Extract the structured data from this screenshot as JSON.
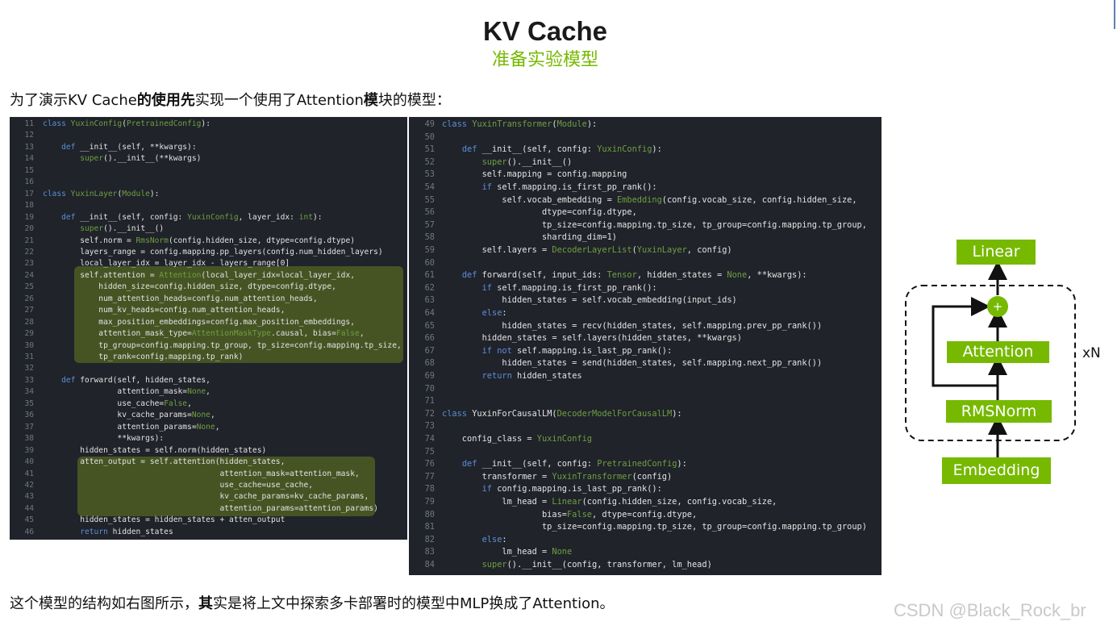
{
  "page": {
    "title": "KV Cache",
    "subtitle": "准备实验模型",
    "intro": {
      "p1": "为了演示KV Cache",
      "p2": "的使用先",
      "p3": "实现一个使用了Attention",
      "p4": "模",
      "p5": "块的模型："
    },
    "outro": {
      "p1": "这个模型的结构如右图所示，",
      "p2": "其",
      "p3": "实是将上文中探索多卡部署时的模型中MLP换成了Attention。"
    },
    "watermark": "CSDN @Black_Rock_br"
  },
  "code_left": {
    "lines": [
      {
        "n": "11",
        "t": "class YuxinConfig(PretrainedConfig):"
      },
      {
        "n": "12",
        "t": ""
      },
      {
        "n": "13",
        "t": "    def __init__(self, **kwargs):"
      },
      {
        "n": "14",
        "t": "        super().__init__(**kwargs)"
      },
      {
        "n": "15",
        "t": ""
      },
      {
        "n": "16",
        "t": ""
      },
      {
        "n": "17",
        "t": "class YuxinLayer(Module):"
      },
      {
        "n": "18",
        "t": ""
      },
      {
        "n": "19",
        "t": "    def __init__(self, config: YuxinConfig, layer_idx: int):"
      },
      {
        "n": "20",
        "t": "        super().__init__()"
      },
      {
        "n": "21",
        "t": "        self.norm = RmsNorm(config.hidden_size, dtype=config.dtype)"
      },
      {
        "n": "22",
        "t": "        layers_range = config.mapping.pp_layers(config.num_hidden_layers)"
      },
      {
        "n": "23",
        "t": "        local_layer_idx = layer_idx - layers_range[0]"
      },
      {
        "n": "24",
        "t": "        self.attention = Attention(local_layer_idx=local_layer_idx,"
      },
      {
        "n": "25",
        "t": "            hidden_size=config.hidden_size, dtype=config.dtype,"
      },
      {
        "n": "26",
        "t": "            num_attention_heads=config.num_attention_heads,"
      },
      {
        "n": "27",
        "t": "            num_kv_heads=config.num_attention_heads,"
      },
      {
        "n": "28",
        "t": "            max_position_embeddings=config.max_position_embeddings,"
      },
      {
        "n": "29",
        "t": "            attention_mask_type=AttentionMaskType.causal, bias=False,"
      },
      {
        "n": "30",
        "t": "            tp_group=config.mapping.tp_group, tp_size=config.mapping.tp_size,"
      },
      {
        "n": "31",
        "t": "            tp_rank=config.mapping.tp_rank)"
      },
      {
        "n": "32",
        "t": ""
      },
      {
        "n": "33",
        "t": "    def forward(self, hidden_states,"
      },
      {
        "n": "34",
        "t": "                attention_mask=None,"
      },
      {
        "n": "35",
        "t": "                use_cache=False,"
      },
      {
        "n": "36",
        "t": "                kv_cache_params=None,"
      },
      {
        "n": "37",
        "t": "                attention_params=None,"
      },
      {
        "n": "38",
        "t": "                **kwargs):"
      },
      {
        "n": "39",
        "t": "        hidden_states = self.norm(hidden_states)"
      },
      {
        "n": "40",
        "t": "        atten_output = self.attention(hidden_states,"
      },
      {
        "n": "41",
        "t": "                                      attention_mask=attention_mask,"
      },
      {
        "n": "42",
        "t": "                                      use_cache=use_cache,"
      },
      {
        "n": "43",
        "t": "                                      kv_cache_params=kv_cache_params,"
      },
      {
        "n": "44",
        "t": "                                      attention_params=attention_params)"
      },
      {
        "n": "45",
        "t": "        hidden_states = hidden_states + atten_output"
      },
      {
        "n": "46",
        "t": "        return hidden_states"
      }
    ]
  },
  "code_right": {
    "lines": [
      {
        "n": "49",
        "t": "class YuxinTransformer(Module):"
      },
      {
        "n": "50",
        "t": ""
      },
      {
        "n": "51",
        "t": "    def __init__(self, config: YuxinConfig):"
      },
      {
        "n": "52",
        "t": "        super().__init__()"
      },
      {
        "n": "53",
        "t": "        self.mapping = config.mapping"
      },
      {
        "n": "54",
        "t": "        if self.mapping.is_first_pp_rank():"
      },
      {
        "n": "55",
        "t": "            self.vocab_embedding = Embedding(config.vocab_size, config.hidden_size,"
      },
      {
        "n": "56",
        "t": "                    dtype=config.dtype,"
      },
      {
        "n": "57",
        "t": "                    tp_size=config.mapping.tp_size, tp_group=config.mapping.tp_group,"
      },
      {
        "n": "58",
        "t": "                    sharding_dim=1)"
      },
      {
        "n": "59",
        "t": "        self.layers = DecoderLayerList(YuxinLayer, config)"
      },
      {
        "n": "60",
        "t": ""
      },
      {
        "n": "61",
        "t": "    def forward(self, input_ids: Tensor, hidden_states = None, **kwargs):"
      },
      {
        "n": "62",
        "t": "        if self.mapping.is_first_pp_rank():"
      },
      {
        "n": "63",
        "t": "            hidden_states = self.vocab_embedding(input_ids)"
      },
      {
        "n": "64",
        "t": "        else:"
      },
      {
        "n": "65",
        "t": "            hidden_states = recv(hidden_states, self.mapping.prev_pp_rank())"
      },
      {
        "n": "66",
        "t": "        hidden_states = self.layers(hidden_states, **kwargs)"
      },
      {
        "n": "67",
        "t": "        if not self.mapping.is_last_pp_rank():"
      },
      {
        "n": "68",
        "t": "            hidden_states = send(hidden_states, self.mapping.next_pp_rank())"
      },
      {
        "n": "69",
        "t": "        return hidden_states"
      },
      {
        "n": "70",
        "t": ""
      },
      {
        "n": "71",
        "t": ""
      },
      {
        "n": "72",
        "t": "class YuxinForCausalLM(DecoderModelForCausalLM):"
      },
      {
        "n": "73",
        "t": ""
      },
      {
        "n": "74",
        "t": "    config_class = YuxinConfig"
      },
      {
        "n": "75",
        "t": ""
      },
      {
        "n": "76",
        "t": "    def __init__(self, config: PretrainedConfig):"
      },
      {
        "n": "77",
        "t": "        transformer = YuxinTransformer(config)"
      },
      {
        "n": "78",
        "t": "        if config.mapping.is_last_pp_rank():"
      },
      {
        "n": "79",
        "t": "            lm_head = Linear(config.hidden_size, config.vocab_size,"
      },
      {
        "n": "80",
        "t": "                    bias=False, dtype=config.dtype,"
      },
      {
        "n": "81",
        "t": "                    tp_size=config.mapping.tp_size, tp_group=config.mapping.tp_group)"
      },
      {
        "n": "82",
        "t": "        else:"
      },
      {
        "n": "83",
        "t": "            lm_head = None"
      },
      {
        "n": "84",
        "t": "        super().__init__(config, transformer, lm_head)"
      }
    ]
  },
  "diagram": {
    "linear": "Linear",
    "attention": "Attention",
    "rmsnorm": "RMSNorm",
    "embedding": "Embedding",
    "plus": "+",
    "repeat": "xN"
  },
  "colors": {
    "accent": "#76b900",
    "code_bg": "#20232a",
    "keyword": "#5a8fd8",
    "class_name": "#6f9f41"
  }
}
